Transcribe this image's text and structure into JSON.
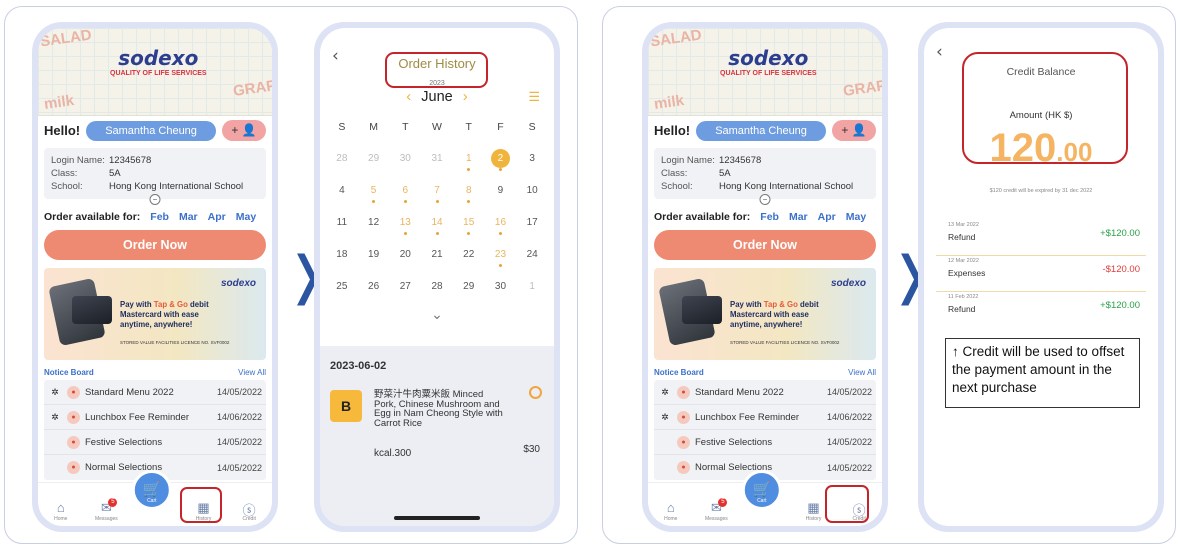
{
  "home": {
    "brand": "sodexo",
    "brand_tagline": "QUALITY OF LIFE SERVICES",
    "doodles": [
      "SALAD",
      "milk",
      "GRAP"
    ],
    "greeting": "Hello!",
    "user_name": "Samantha Cheung",
    "add_user_label": "+ 👤",
    "info": {
      "login_label": "Login Name:",
      "login_value": "12345678",
      "class_label": "Class:",
      "class_value": "5A",
      "school_label": "School:",
      "school_value": "Hong Kong International School"
    },
    "order_available_label": "Order available for:",
    "months": [
      "Feb",
      "Mar",
      "Apr",
      "May"
    ],
    "order_now": "Order Now",
    "promo": {
      "logo": "sodexo",
      "line1_a": "Pay with ",
      "line1_hl": "Tap & Go",
      "line1_b": " debit",
      "line2": "Mastercard with ease",
      "line3": "anytime, anywhere!",
      "small": "STORED VALUE FACILITIES LICENCE NO. SVF0002"
    },
    "notice_title": "Notice Board",
    "view_all": "View All",
    "notices": [
      {
        "title": "Standard Menu 2022",
        "date": "14/05/2022",
        "pinned": true
      },
      {
        "title": "Lunchbox Fee Reminder",
        "date": "14/06/2022",
        "pinned": true
      },
      {
        "title": "Festive Selections",
        "date": "14/05/2022",
        "pinned": false
      },
      {
        "title": "Normal Selections",
        "date": "14/05/2022",
        "pinned": false
      }
    ],
    "tabs": {
      "home": "Home",
      "messages": "Messages",
      "cart": "Cart",
      "history": "History",
      "credit": "Credit"
    },
    "message_badge": "5"
  },
  "order_history": {
    "title": "Order History",
    "year": "2023",
    "month": "June",
    "weekdays": [
      "S",
      "M",
      "T",
      "W",
      "T",
      "F",
      "S"
    ],
    "weeks": [
      [
        "28",
        "29",
        "30",
        "31",
        "1",
        "2",
        "3"
      ],
      [
        "4",
        "5",
        "6",
        "7",
        "8",
        "9",
        "10"
      ],
      [
        "11",
        "12",
        "13",
        "14",
        "15",
        "16",
        "17"
      ],
      [
        "18",
        "19",
        "20",
        "21",
        "22",
        "23",
        "24"
      ],
      [
        "25",
        "26",
        "27",
        "28",
        "29",
        "30",
        "1"
      ]
    ],
    "date_heading": "2023-06-02",
    "item": {
      "set": "B",
      "name": "野菜汁牛肉粟米飯 Minced Pork, Chinese Mushroom and Egg in Nam Cheong Style with Carrot Rice",
      "kcal": "kcal.300",
      "price": "$30"
    }
  },
  "credit": {
    "title": "Credit Balance",
    "amount_label": "Amount (HK $)",
    "amount_int": "120",
    "amount_dec": ".00",
    "expiry_note": "$120 credit will be expired by 31 dec 2022",
    "transactions": [
      {
        "date": "13 Mar 2022",
        "type": "Refund",
        "amount": "+$120.00",
        "sign": "pos"
      },
      {
        "date": "12 Mar 2022",
        "type": "Expenses",
        "amount": "-$120.00",
        "sign": "neg"
      },
      {
        "date": "11 Feb 2022",
        "type": "Refund",
        "amount": "+$120.00",
        "sign": "pos"
      }
    ]
  },
  "annotation": "↑ Credit will be used to offset the payment amount in the next purchase",
  "arrow_glyph": "❭",
  "colors": {
    "accent_blue": "#4f8de0",
    "coral": "#ee8a72",
    "highlight_red": "#c3252b",
    "gold": "#f0b43c"
  }
}
